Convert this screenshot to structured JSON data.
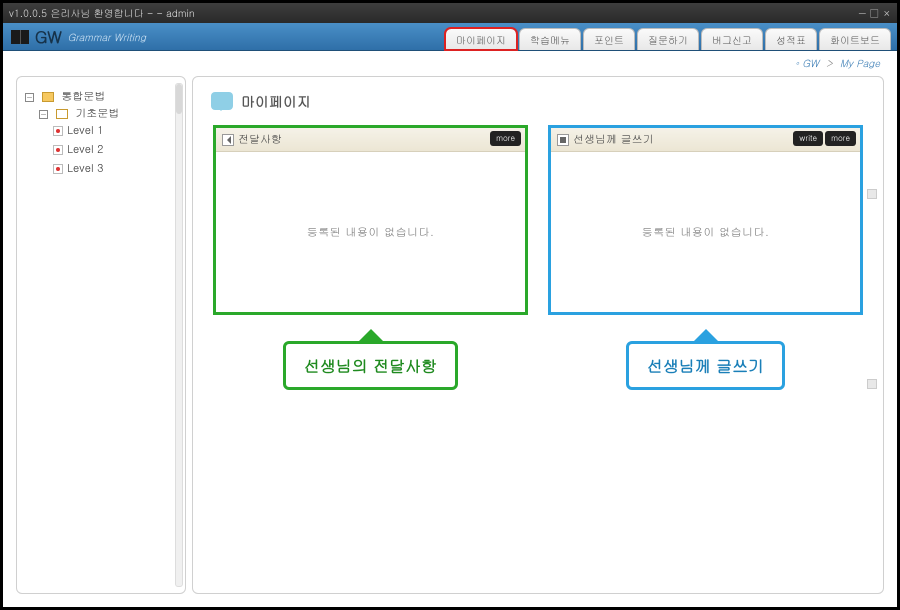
{
  "window": {
    "title": "v1.0.0.5 은리사님 환영합니다 - - admin"
  },
  "brand": {
    "name": "GW",
    "subtitle": "Grammar Writing"
  },
  "topTabs": [
    {
      "label": "마이페이지",
      "highlight": true
    },
    {
      "label": "학습메뉴",
      "highlight": false
    },
    {
      "label": "포인트",
      "highlight": false
    },
    {
      "label": "질문하기",
      "highlight": false
    },
    {
      "label": "버그신고",
      "highlight": false
    },
    {
      "label": "성적표",
      "highlight": false
    },
    {
      "label": "화이트보드",
      "highlight": false
    }
  ],
  "breadcrumb": {
    "a": "GW",
    "b": "My Page"
  },
  "sidebar": {
    "root": "통합문법",
    "group": "기초문법",
    "levels": [
      "Level 1",
      "Level 2",
      "Level 3"
    ]
  },
  "page": {
    "title": "마이페이지"
  },
  "panels": {
    "left": {
      "title": "전달사항",
      "buttons": [
        "more"
      ],
      "empty": "등록된 내용이 없습니다.",
      "callout": "선생님의 전달사항"
    },
    "right": {
      "title": "선생님께 글쓰기",
      "buttons": [
        "write",
        "more"
      ],
      "empty": "등록된 내용이 없습니다.",
      "callout": "선생님께 글쓰기"
    }
  }
}
